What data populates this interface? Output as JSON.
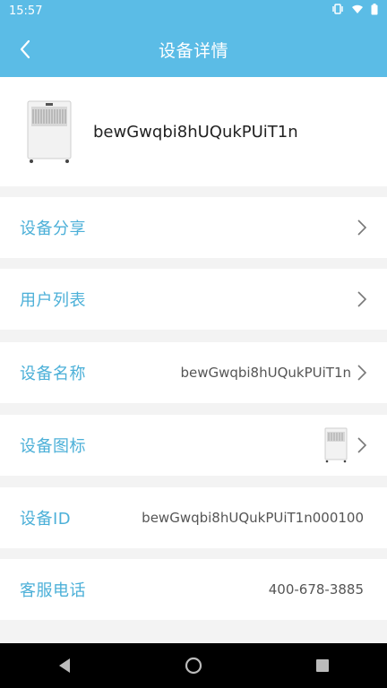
{
  "status": {
    "time": "15:57"
  },
  "appbar": {
    "title": "设备详情",
    "back_icon": "chevron-left-icon"
  },
  "device": {
    "name": "bewGwqbi8hUQukPUiT1n"
  },
  "rows": [
    {
      "label": "设备分享"
    },
    {
      "label": "用户列表"
    },
    {
      "label": "设备名称",
      "value": "bewGwqbi8hUQukPUiT1n"
    },
    {
      "label": "设备图标"
    },
    {
      "label": "设备ID",
      "value": "bewGwqbi8hUQukPUiT1n000100"
    },
    {
      "label": "客服电话",
      "value": "400-678-3885"
    }
  ],
  "colors": {
    "primary": "#5bbce6",
    "label": "#4cb0d8",
    "background": "#f3f3f3"
  }
}
